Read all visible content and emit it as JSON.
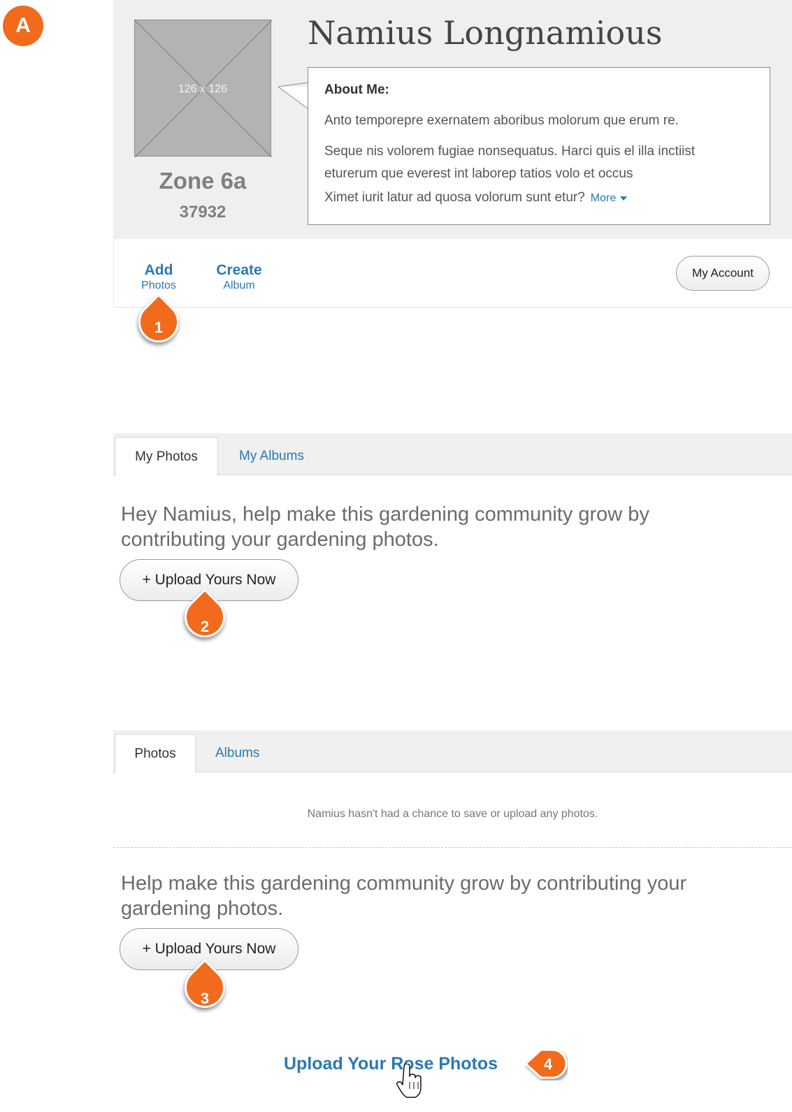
{
  "corner_badge": "A",
  "profile": {
    "avatar_placeholder": "126 x 126",
    "zone": "Zone 6a",
    "zip": "37932",
    "name": "Namius Longnamious",
    "about": {
      "title": "About Me:",
      "line1": "Anto temporepre exernatem aboribus molorum que erum re.",
      "line2": "Seque nis volorem fugiae nonsequatus. Harci quis el illa inctiist",
      "line3": "eturerum que everest int laborep tatios volo et occus",
      "line4": "Ximet iurit latur ad quosa volorum sunt etur?",
      "more_label": "More"
    }
  },
  "actions": {
    "add_big": "Add",
    "add_small": "Photos",
    "create_big": "Create",
    "create_small": "Album",
    "my_account": "My Account"
  },
  "section1": {
    "tab_active": "My Photos",
    "tab_inactive": "My Albums",
    "prompt_line1": "Hey Namius, help make this gardening community grow by",
    "prompt_line2": "contributing your gardening photos.",
    "upload_label": "+ Upload Yours Now"
  },
  "section2": {
    "tab_active": "Photos",
    "tab_inactive": "Albums",
    "empty_message": "Namius hasn't had a chance to save or upload any photos.",
    "prompt_line1": "Help make this gardening community grow by contributing your",
    "prompt_line2": "gardening photos.",
    "upload_label": "+ Upload Yours Now",
    "rose_link": "Upload Your Rose Photos"
  },
  "callouts": [
    "1",
    "2",
    "3",
    "4"
  ],
  "colors": {
    "accent_orange": "#f26a1b",
    "link_blue": "#2a79b4",
    "panel_gray": "#efefef"
  }
}
